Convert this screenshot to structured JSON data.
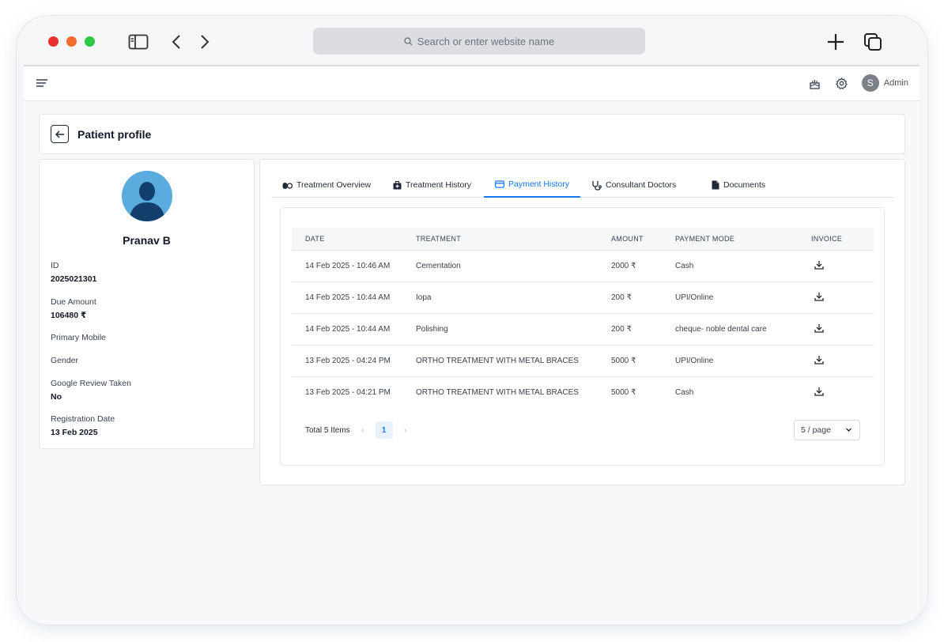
{
  "browser": {
    "url_placeholder": "Search or enter website name"
  },
  "topbar": {
    "user_initial": "S",
    "user_label": "Admin"
  },
  "header": {
    "title": "Patient profile"
  },
  "profile": {
    "name": "Pranav B",
    "fields": [
      {
        "label": "ID",
        "value": "2025021301"
      },
      {
        "label": "Due Amount",
        "value": "106480 ₹"
      },
      {
        "label": "Primary Mobile",
        "value": ""
      },
      {
        "label": "Gender",
        "value": ""
      },
      {
        "label": "Google Review Taken",
        "value": "No"
      },
      {
        "label": "Registration Date",
        "value": "13 Feb 2025"
      }
    ]
  },
  "tabs": [
    {
      "label": "Treatment Overview",
      "icon": "pills-icon"
    },
    {
      "label": "Treatment History",
      "icon": "medical-kit-icon"
    },
    {
      "label": "Payment History",
      "icon": "credit-card-icon",
      "active": true
    },
    {
      "label": "Consultant Doctors",
      "icon": "stethoscope-icon"
    },
    {
      "label": "Documents",
      "icon": "document-icon"
    }
  ],
  "table": {
    "headers": [
      "DATE",
      "TREATMENT",
      "AMOUNT",
      "PAYMENT MODE",
      "INVOICE"
    ],
    "rows": [
      {
        "date": "14 Feb 2025 - 10:46 AM",
        "treatment": "Cementation",
        "amount": "2000 ₹",
        "mode": "Cash"
      },
      {
        "date": "14 Feb 2025 - 10:44 AM",
        "treatment": "Iopa",
        "amount": "200 ₹",
        "mode": "UPI/Online"
      },
      {
        "date": "14 Feb 2025 - 10:44 AM",
        "treatment": "Polishing",
        "amount": "200 ₹",
        "mode": "cheque- noble dental care"
      },
      {
        "date": "13 Feb 2025 - 04:24 PM",
        "treatment": "ORTHO TREATMENT WITH METAL BRACES",
        "amount": "5000 ₹",
        "mode": "UPI/Online"
      },
      {
        "date": "13 Feb 2025 - 04:21 PM",
        "treatment": "ORTHO TREATMENT WITH METAL BRACES",
        "amount": "5000 ₹",
        "mode": "Cash"
      }
    ]
  },
  "pagination": {
    "total_label": "Total 5 Items",
    "current_page": "1",
    "page_size": "5 / page"
  },
  "colors": {
    "accent": "#1677ff",
    "traffic_red": "#e8322f",
    "traffic_orange": "#f26b2b",
    "traffic_green": "#2fc845"
  }
}
